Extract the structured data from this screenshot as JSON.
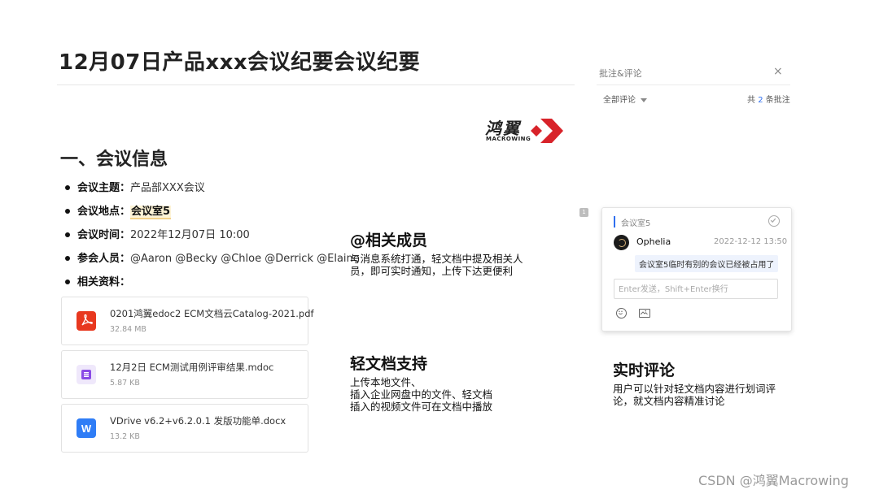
{
  "doc": {
    "title": "12月07日产品xxx会议纪要会议纪要",
    "section_heading": "一、会议信息",
    "info": [
      {
        "label": "会议主题：",
        "value": "产品部XXX会议"
      },
      {
        "label": "会议地点：",
        "value": "会议室5"
      },
      {
        "label": "会议时间：",
        "value": "2022年12月07日 10:00"
      },
      {
        "label": "参会人员：",
        "value": "@Aaron @Becky @Chloe @Derrick @Elaine"
      },
      {
        "label": "相关资料：",
        "value": ""
      }
    ],
    "files": [
      {
        "name": "0201鸿翼edoc2 ECM文档云Catalog-2021.pdf",
        "size": "32.84 MB",
        "icon": "pdf-icon"
      },
      {
        "name": "12月2日 ECM测试用例评审结果.mdoc",
        "size": "5.87 KB",
        "icon": "mdoc-icon"
      },
      {
        "name": "VDrive v6.2+v6.2.0.1 发版功能单.docx",
        "size": "13.2 KB",
        "icon": "word-icon"
      }
    ]
  },
  "logo": {
    "name": "鸿翼",
    "sub": "MACROWING"
  },
  "features": {
    "mentions": {
      "title": "@相关成员",
      "desc": "与消息系统打通，轻文档中提及相关人员，即可实时通知，上传下达更便利"
    },
    "lightdoc": {
      "title": "轻文档支持",
      "lines": [
        "上传本地文件、",
        "插入企业网盘中的文件、轻文档",
        "插入的视频文件可在文档中播放"
      ]
    },
    "realtime": {
      "title": "实时评论",
      "desc": "用户可以针对轻文档内容进行划词评论，就文档内容精准讨论"
    }
  },
  "comments_panel": {
    "title": "批注&评论",
    "close_label": "×",
    "filter_label": "全部评论",
    "count_prefix": "共",
    "count": "2",
    "count_suffix": "条批注",
    "marker": "1",
    "card": {
      "quote": "会议室5",
      "author": "Ophelia",
      "time": "2022-12-12 13:50",
      "body": "会议室5临时有别的会议已经被占用了",
      "reply_placeholder": "Enter发送，Shift+Enter换行"
    }
  },
  "watermark": "CSDN @鸿翼Macrowing",
  "colors": {
    "accent": "#2f6fef",
    "highlight": "#fdf3d6",
    "pdf": "#e8381f",
    "mdoc": "#8a4be6",
    "docx": "#2f7df6",
    "logo_red": "#d8232a"
  }
}
